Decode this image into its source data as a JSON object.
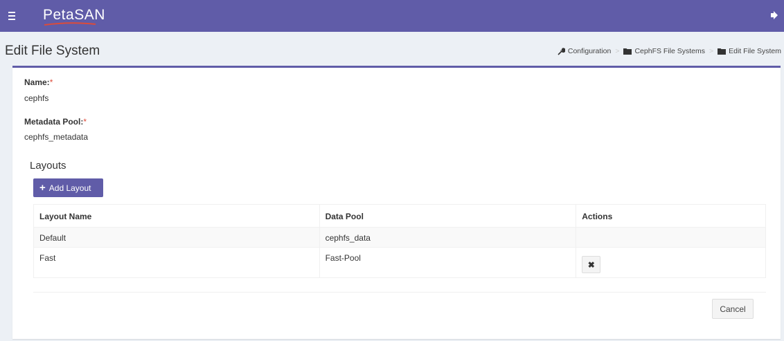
{
  "app": {
    "logo_text": "PetaSAN"
  },
  "header": {
    "page_title": "Edit File System"
  },
  "breadcrumb": [
    {
      "label": "Configuration",
      "icon": "wrench-icon"
    },
    {
      "label": "CephFS File Systems",
      "icon": "folder-icon"
    },
    {
      "label": "Edit File System",
      "icon": "folder-icon"
    }
  ],
  "form": {
    "name_label": "Name:",
    "name_value": "cephfs",
    "metadata_label": "Metadata Pool:",
    "metadata_value": "cephfs_metadata",
    "required_marker": "*"
  },
  "layouts": {
    "title": "Layouts",
    "add_button_label": "Add Layout",
    "columns": [
      "Layout Name",
      "Data Pool",
      "Actions"
    ],
    "rows": [
      {
        "name": "Default",
        "pool": "cephfs_data"
      },
      {
        "name": "Fast",
        "pool": "Fast-Pool"
      }
    ],
    "delete_glyph": "✖"
  },
  "footer": {
    "cancel_label": "Cancel"
  },
  "colors": {
    "brand": "#605ca8",
    "required": "#dd4b39",
    "logo_swoosh": "#dd4b39"
  }
}
